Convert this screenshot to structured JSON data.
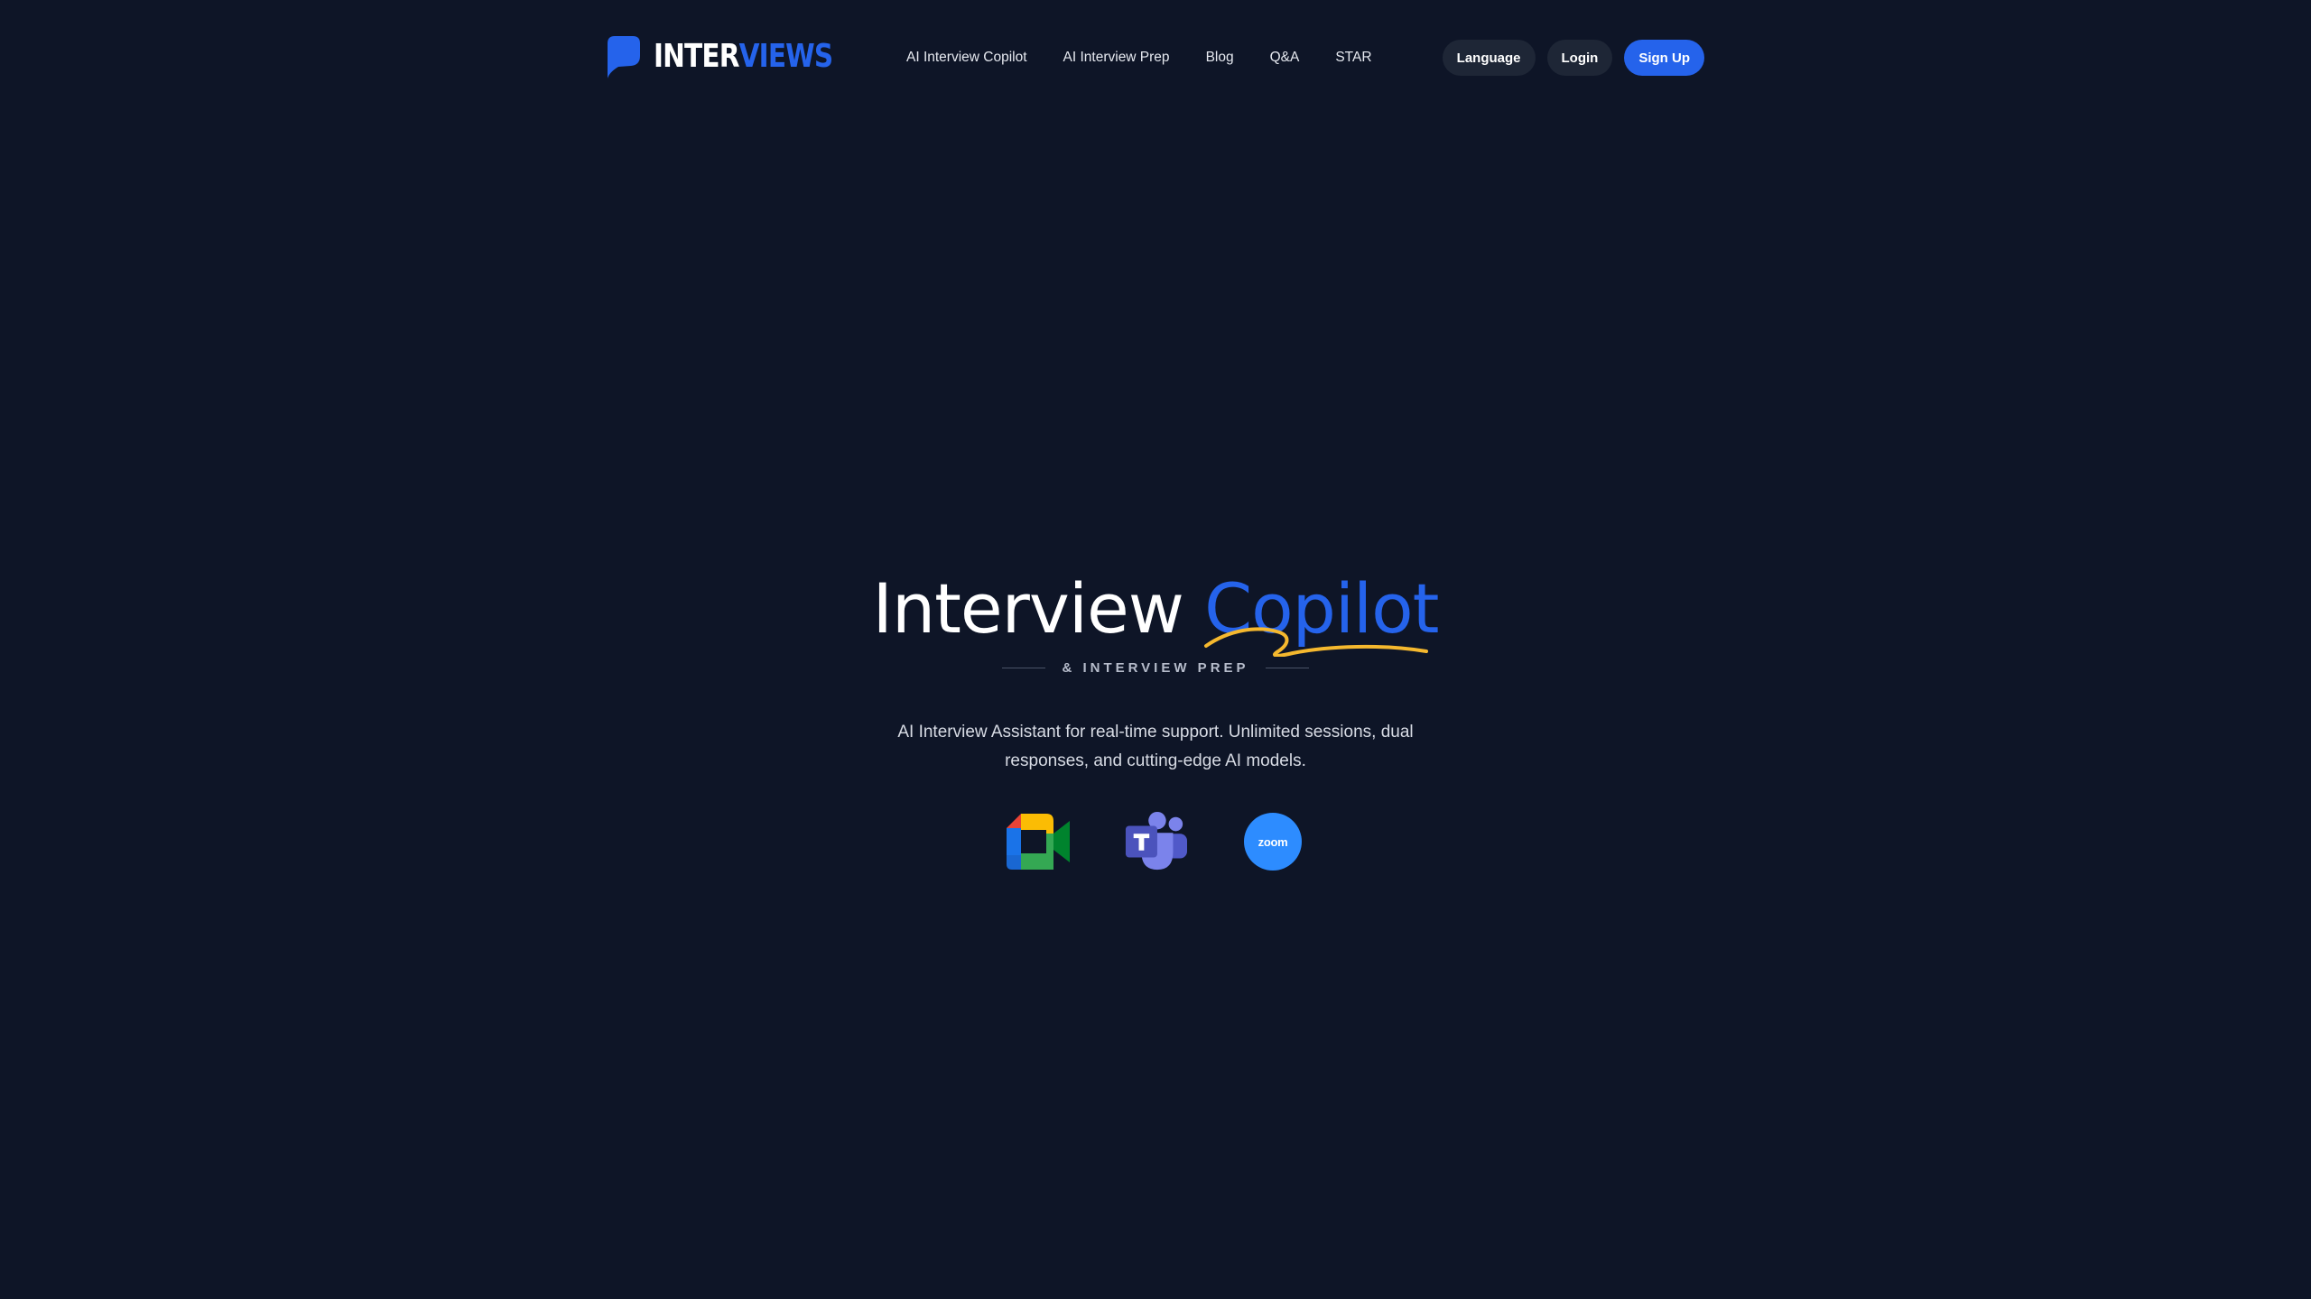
{
  "brand": {
    "name_part_a": "INTER",
    "name_part_b": "VIEWS",
    "accent_color": "#2563eb",
    "logo_icon": "speech-bubble-icon"
  },
  "nav": {
    "items": [
      {
        "label": "AI Interview Copilot"
      },
      {
        "label": "AI Interview Prep"
      },
      {
        "label": "Blog"
      },
      {
        "label": "Q&A"
      },
      {
        "label": "STAR"
      }
    ]
  },
  "actions": {
    "language_label": "Language",
    "login_label": "Login",
    "signup_label": "Sign Up"
  },
  "hero": {
    "title_part_a": "Interview",
    "title_part_b": "Copilot",
    "subtitle": "& INTERVIEW PREP",
    "description": "AI Interview Assistant for real-time support. Unlimited sessions, dual responses, and cutting-edge AI models.",
    "underline_color": "#f5b82e"
  },
  "platforms": [
    {
      "name": "Google Meet",
      "icon": "google-meet-icon"
    },
    {
      "name": "Microsoft Teams",
      "icon": "microsoft-teams-icon"
    },
    {
      "name": "Zoom",
      "icon": "zoom-icon",
      "label": "zoom"
    }
  ],
  "colors": {
    "background": "#0e1527",
    "button_dark": "#1e2636",
    "button_primary": "#2563eb",
    "zoom_blue": "#2d8cff"
  }
}
